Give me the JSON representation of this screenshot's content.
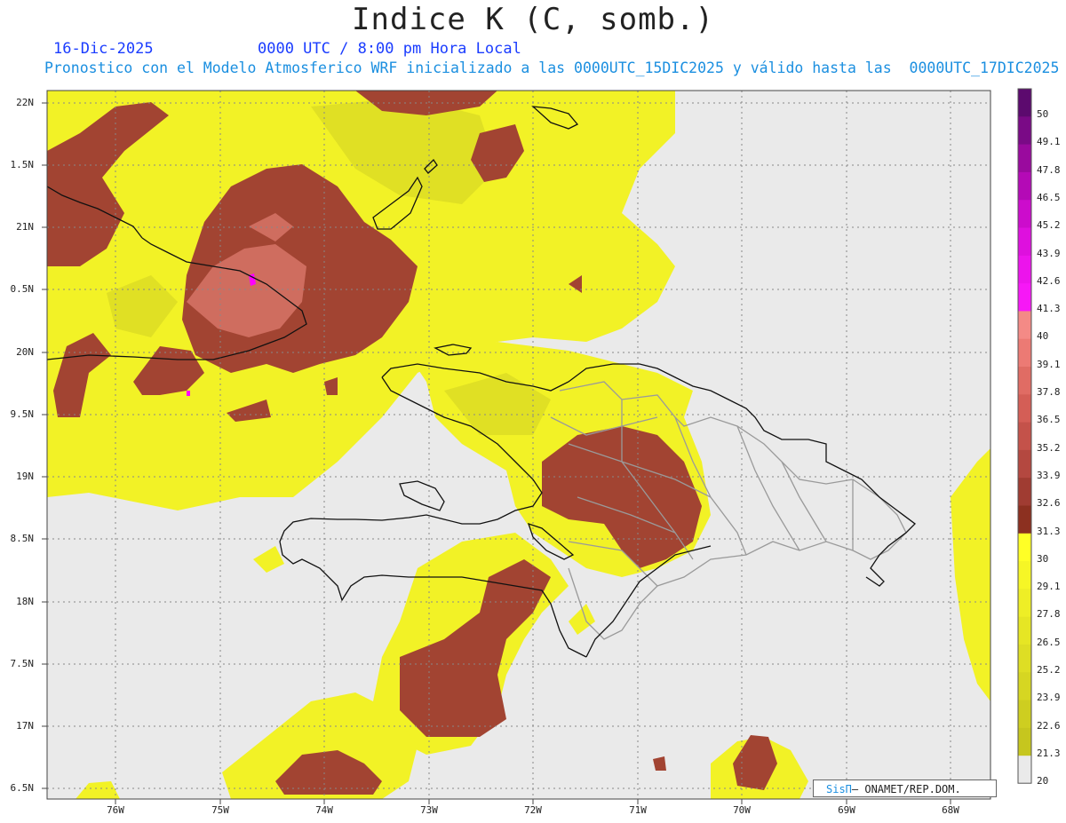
{
  "header": {
    "title": "Indice K (C, somb.)",
    "date": "16-Dic-2025",
    "time": "0000 UTC / 8:00 pm Hora Local",
    "description": "Pronostico con el Modelo Atmosferico WRF inicializado a las 0000UTC_15DIC2025 y válido hasta las  0000UTC_17DIC2025"
  },
  "axes": {
    "lat_labels": [
      "22N",
      "1.5N",
      "21N",
      "0.5N",
      "20N",
      "9.5N",
      "19N",
      "8.5N",
      "18N",
      "7.5N",
      "17N",
      "6.5N"
    ],
    "lon_labels": [
      "76W",
      "75W",
      "74W",
      "73W",
      "72W",
      "71W",
      "70W",
      "69W",
      "68W"
    ]
  },
  "colorbar": {
    "labels": [
      "50",
      "49.1",
      "47.8",
      "46.5",
      "45.2",
      "43.9",
      "42.6",
      "41.3",
      "40",
      "39.1",
      "37.8",
      "36.5",
      "35.2",
      "33.9",
      "32.6",
      "31.3",
      "30",
      "29.1",
      "27.8",
      "26.5",
      "25.2",
      "23.9",
      "22.6",
      "21.3",
      "20"
    ],
    "colors": [
      "#5c0a6e",
      "#7a0a86",
      "#9a0a9e",
      "#b40ab6",
      "#cc0ccc",
      "#de10de",
      "#ec14ec",
      "#f618f6",
      "#f48a86",
      "#ec7a74",
      "#e06c64",
      "#d45e56",
      "#c4524a",
      "#b44840",
      "#a03c32",
      "#8c3020",
      "#ffff26",
      "#f6f626",
      "#eeee26",
      "#e6e624",
      "#dede24",
      "#d6d622",
      "#cece20",
      "#c6c61e"
    ],
    "low_color": "#eaeaea"
  },
  "credit": {
    "brand": "SisΠ",
    "org": "– ONAMET/REP.DOM."
  },
  "colors": {
    "background": "#eaeaea",
    "yellow": "#f2f226",
    "olive": "#c8c820",
    "brown": "#a24432",
    "pink": "#cf6d5f",
    "magenta": "#ff00ff"
  }
}
